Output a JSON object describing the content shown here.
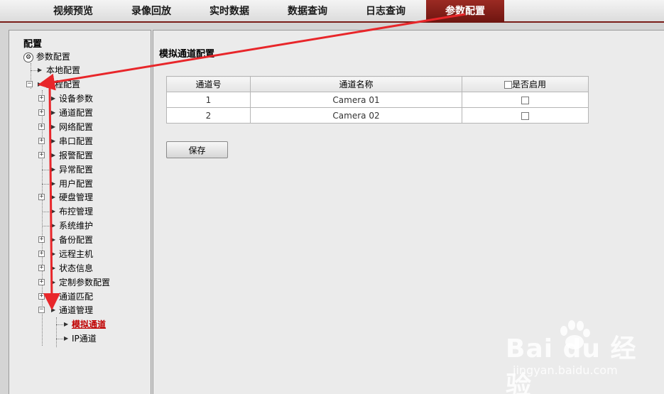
{
  "nav": {
    "tabs": [
      {
        "label": "视频预览"
      },
      {
        "label": "录像回放"
      },
      {
        "label": "实时数据"
      },
      {
        "label": "数据查询"
      },
      {
        "label": "日志查询"
      },
      {
        "label": "参数配置",
        "active": true
      }
    ]
  },
  "sidebar": {
    "title": "配置",
    "root": "参数配置",
    "local": "本地配置",
    "remote": "远程配置",
    "items": [
      {
        "label": "设备参数",
        "expandable": true
      },
      {
        "label": "通道配置",
        "expandable": true
      },
      {
        "label": "网络配置",
        "expandable": true
      },
      {
        "label": "串口配置",
        "expandable": true
      },
      {
        "label": "报警配置",
        "expandable": true
      },
      {
        "label": "异常配置",
        "expandable": false
      },
      {
        "label": "用户配置",
        "expandable": false
      },
      {
        "label": "硬盘管理",
        "expandable": true
      },
      {
        "label": "布控管理",
        "expandable": false
      },
      {
        "label": "系统维护",
        "expandable": false
      },
      {
        "label": "备份配置",
        "expandable": true
      },
      {
        "label": "远程主机",
        "expandable": true
      },
      {
        "label": "状态信息",
        "expandable": true
      },
      {
        "label": "定制参数配置",
        "expandable": true
      },
      {
        "label": "通道匹配",
        "expandable": true
      },
      {
        "label": "通道管理",
        "expandable": true,
        "expanded": true
      }
    ],
    "sub_items": [
      {
        "label": "模拟通道",
        "selected": true
      },
      {
        "label": "IP通道"
      }
    ]
  },
  "main": {
    "title": "模拟通道配置",
    "table": {
      "headers": [
        "通道号",
        "通道名称",
        "是否启用"
      ],
      "rows": [
        {
          "no": "1",
          "name": "Camera 01",
          "enabled": false
        },
        {
          "no": "2",
          "name": "Camera 02",
          "enabled": false
        }
      ]
    },
    "save_label": "保存"
  },
  "watermark": {
    "text": "Bai du 经验",
    "url": "jingyan.baidu.com"
  },
  "colors": {
    "active_tab": "#7a1d18",
    "annotation_arrow": "#e8262a",
    "selected_item": "#c00000"
  }
}
